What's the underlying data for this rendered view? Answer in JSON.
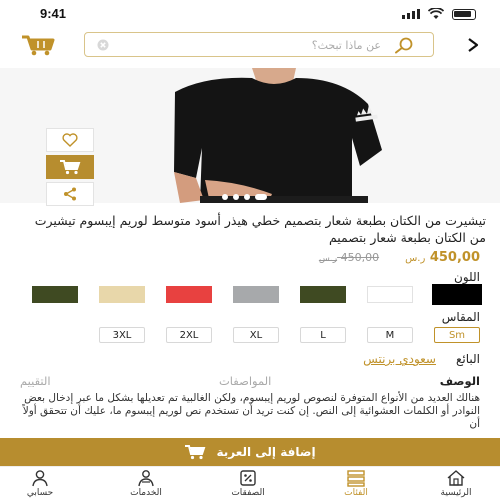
{
  "status_bar": {
    "time": "9:41"
  },
  "header": {
    "search_placeholder": "عن ماذا تبحث؟"
  },
  "product": {
    "title": "تيشيرت من الكتان بطبعة شعار بتصميم خطي هيذر أسود متوسط لوريم إيبسوم تيشيرت من الكتان بطبعة شعار بتصميم",
    "price_current": "450,00",
    "price_old": "450,00",
    "currency": "ر.س",
    "color_label": "اللون",
    "colors": [
      "#000000",
      "#ffffff",
      "#3f4a22",
      "#a7a9ab",
      "#e84140",
      "#e8d7aa",
      "#3f4a22"
    ],
    "selected_color_index": 0,
    "size_label": "المقاس",
    "sizes": [
      "Sm",
      "M",
      "L",
      "XL",
      "2XL",
      "3XL"
    ],
    "selected_size_index": 0,
    "seller_label": "البائع",
    "seller_name": "سعودي برنتس",
    "tabs": [
      "الوصف",
      "المواصفات",
      "التقييم"
    ],
    "active_tab_index": 0,
    "description": "هنالك العديد من الأنواع المتوفرة لنصوص لوريم إيبسوم، ولكن الغالبية تم تعديلها بشكل ما عبر إدخال بعض النوادر أو الكلمات العشوائية إلى النص. إن كنت تريد أن تستخدم نص لوريم إيبسوم ما، عليك أن تتحقق أولاً أن",
    "add_to_cart": "إضافة إلى العربة"
  },
  "bottom_nav": {
    "items": [
      "الرئيسية",
      "الفئات",
      "الصفقات",
      "الخدمات",
      "حسابي"
    ],
    "active_index": 1
  },
  "colors": {
    "accent": "#b78d2f",
    "accent_text": "#c0922a"
  }
}
